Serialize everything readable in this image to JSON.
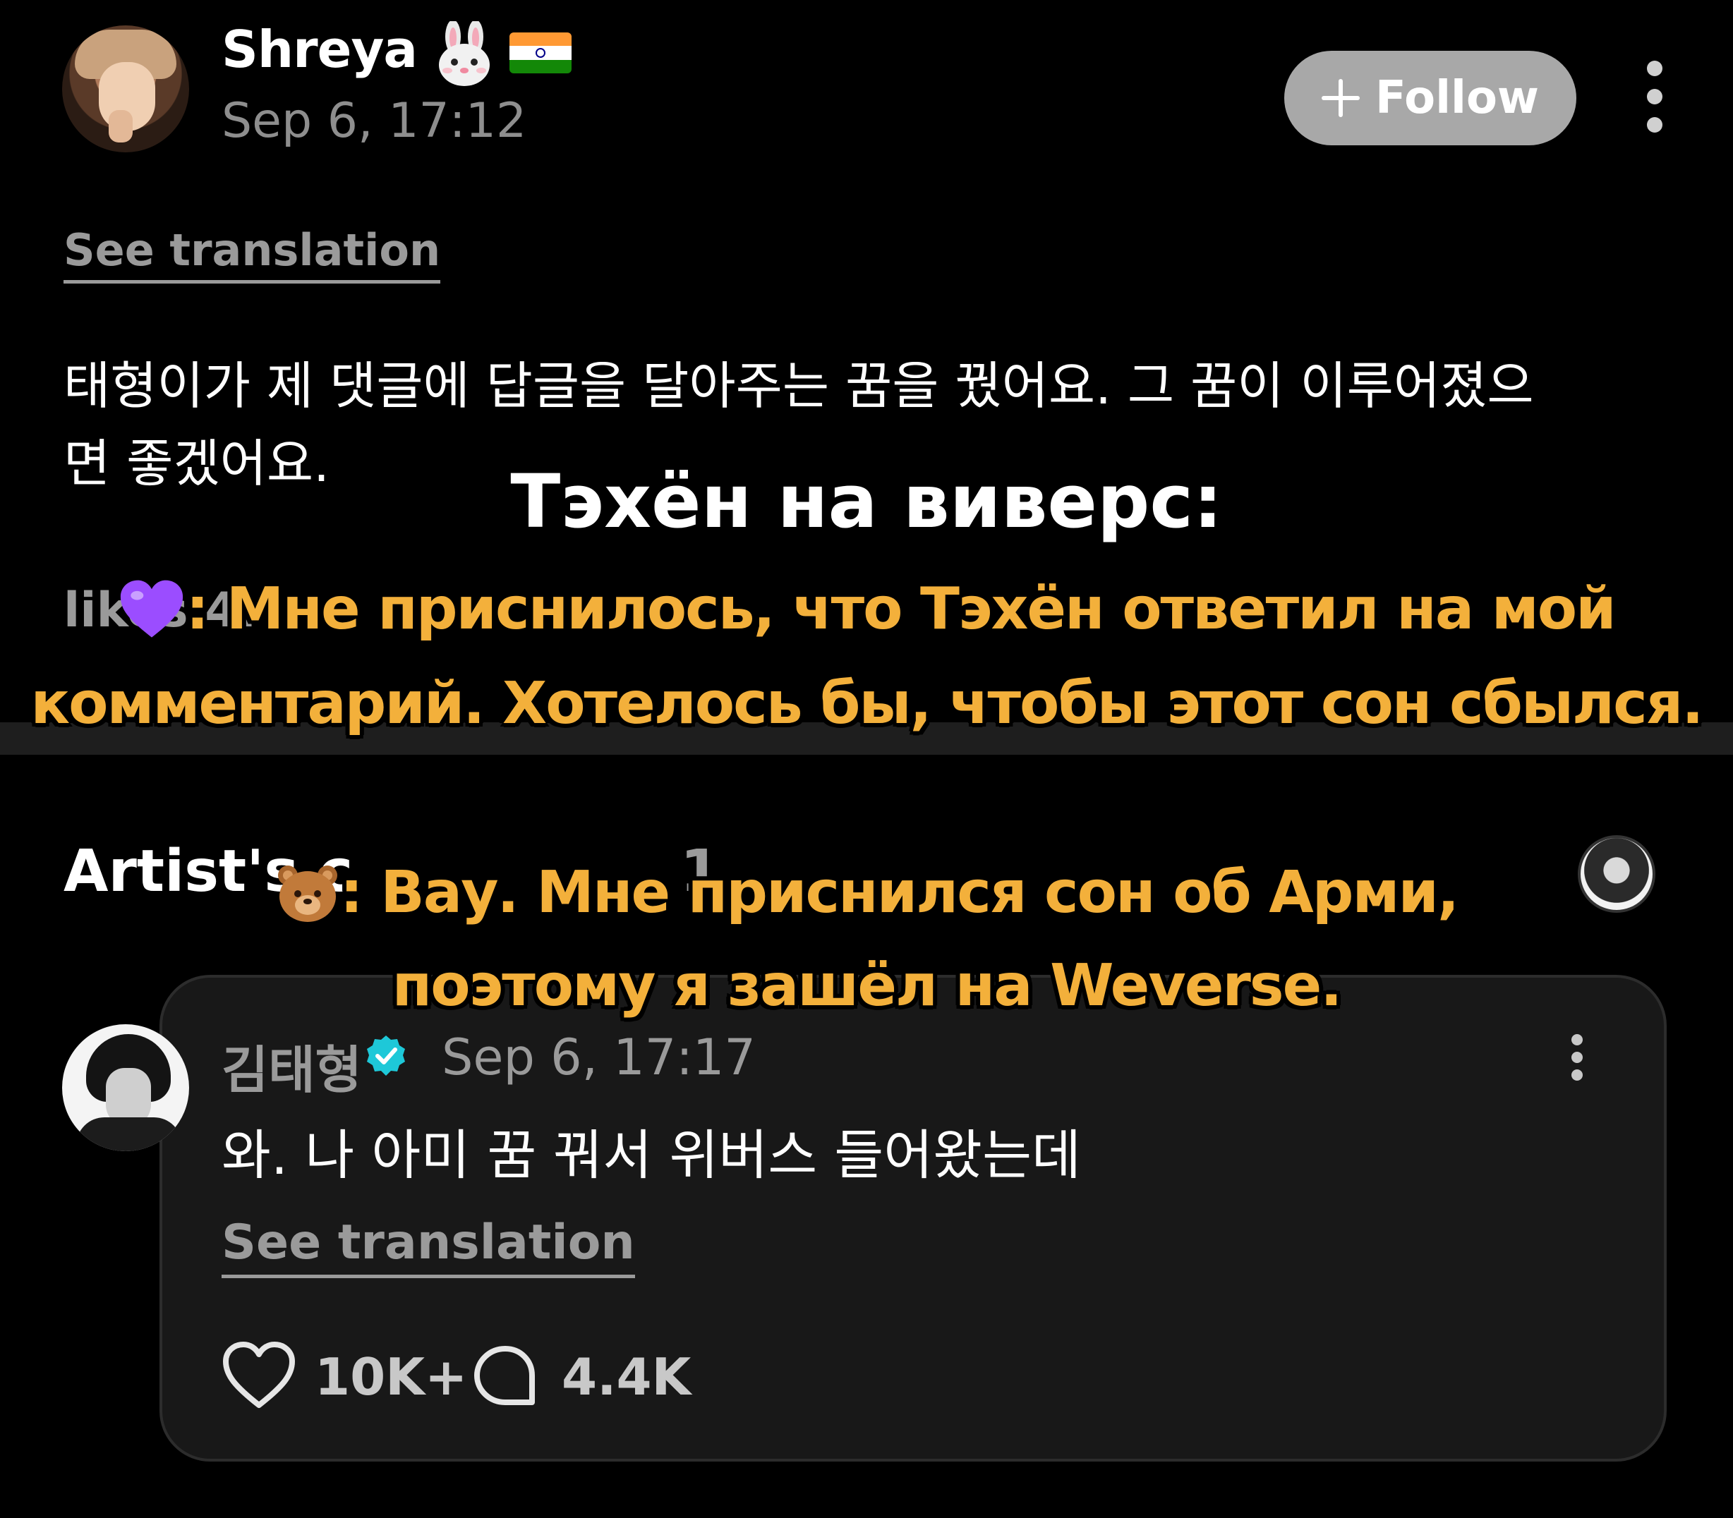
{
  "post": {
    "author_name": "Shreya",
    "author_emoji": "rabbit-face-emoji",
    "author_flag": "india-flag",
    "timestamp": "Sep 6, 17:12",
    "follow_label": "Follow",
    "see_translation": "See translation",
    "body": "태형이가 제 댓글에 답글을 달아주는 꿈을 꿨어요. 그 꿈이 이루어졌으\n면 좋겠어요.",
    "likes_label": "likes",
    "likes_count_partial": "4."
  },
  "artist_section": {
    "heading": "Artist's c",
    "count": "1"
  },
  "comment": {
    "author": "김태형",
    "timestamp": "Sep 6, 17:17",
    "body": "와. 나 아미 꿈 꿔서 위버스 들어왔는데",
    "see_translation": "See translation",
    "likes": "10K+",
    "replies": "4.4K"
  },
  "overlay": {
    "heading": "Тэхён на виверс:",
    "line_1": ": Мне приснилось, что Тэхён ответил на мой",
    "line_2": "комментарий. Хотелось бы, чтобы этот сон сбылся.",
    "line_3": ": Вау. Мне приснился сон об Арми,",
    "line_4": "поэтому я зашёл на Weverse."
  },
  "colors": {
    "background": "#000000",
    "caption": "#f3b03b",
    "follow_button": "#a8a8a8",
    "verified": "#1ec8d8",
    "muted_text": "#9a9a9a"
  }
}
